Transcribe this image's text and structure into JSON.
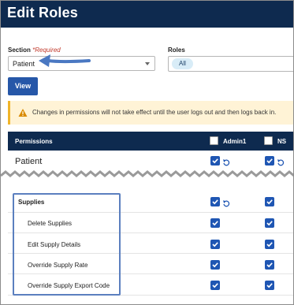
{
  "header": {
    "title": "Edit Roles"
  },
  "form": {
    "section_label": "Section",
    "section_required": "*Required",
    "section_value": "Patient",
    "roles_label": "Roles",
    "roles_value": "All",
    "view_button": "View"
  },
  "alert": {
    "icon": "warning-icon",
    "message": "Changes in permissions will not take effect until the user logs out and then logs back in."
  },
  "table": {
    "header": {
      "permissions": "Permissions",
      "role1": "Admin1",
      "role2": "NS"
    },
    "section_row": "Patient",
    "group": "Supplies",
    "items": [
      "Delete Supplies",
      "Edit Supply Details",
      "Override Supply Rate",
      "Override Supply Export Code"
    ]
  },
  "colors": {
    "header_bg": "#0e2a4f",
    "accent": "#1f56b3",
    "alert_bg": "#fff3d6",
    "alert_border": "#f0b429",
    "annotation": "#5b7fbf"
  }
}
